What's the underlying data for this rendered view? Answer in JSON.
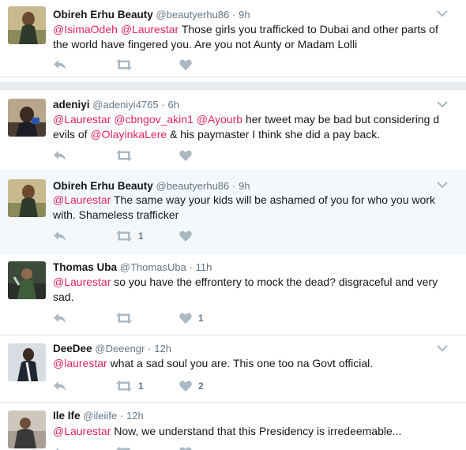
{
  "tweets": [
    {
      "name": "Obireh Erhu Beauty",
      "handle": "@beautyerhu86",
      "time": "9h",
      "mentions": [
        "@IsimaOdeh",
        "@Laurestar"
      ],
      "text": "Those girls you trafficked to Dubai and other parts of the world have fingered you. Are you not Aunty or Madam Lolli",
      "retweets": "",
      "likes": ""
    },
    {
      "name": "adeniyi",
      "handle": "@adeniyi4765",
      "time": "6h",
      "mentions": [
        "@Laurestar",
        "@cbngov_akin1",
        "@Ayourb"
      ],
      "text_a": "her tweet may be bad but considering d evils of",
      "mention_mid": "@OlayinkaLere",
      "text_b": "& his paymaster I think she did a pay back.",
      "retweets": "",
      "likes": ""
    },
    {
      "name": "Obireh Erhu Beauty",
      "handle": "@beautyerhu86",
      "time": "9h",
      "mentions": [
        "@Laurestar"
      ],
      "text": "The same way your kids will be ashamed of you for who you work with. Shameless trafficker",
      "retweets": "1",
      "likes": ""
    },
    {
      "name": "Thomas Uba",
      "handle": "@ThomasUba",
      "time": "11h",
      "mentions": [
        "@Laurestar"
      ],
      "text": "so you have the effrontery to mock the dead? disgraceful and very sad.",
      "retweets": "",
      "likes": "1"
    },
    {
      "name": "DeeDee",
      "handle": "@Deeengr",
      "time": "12h",
      "mentions": [
        "@laurestar"
      ],
      "text": "what a sad soul you are. This one too na Govt official.",
      "retweets": "1",
      "likes": "2"
    },
    {
      "name": "Ile Ife",
      "handle": "@ileiife",
      "time": "12h",
      "mentions": [
        "@Laurestar"
      ],
      "text": "Now, we understand that this Presidency is irredeemable...",
      "retweets": "",
      "likes": ""
    }
  ],
  "sep": "·",
  "icons": [
    "reply-icon",
    "retweet-icon",
    "heart-icon",
    "chevron-down-icon"
  ],
  "colors": {
    "mention": "#e0245e",
    "muted": "#657786",
    "icon": "#aab8c2",
    "highlight_bg": "#f5f8fa"
  }
}
